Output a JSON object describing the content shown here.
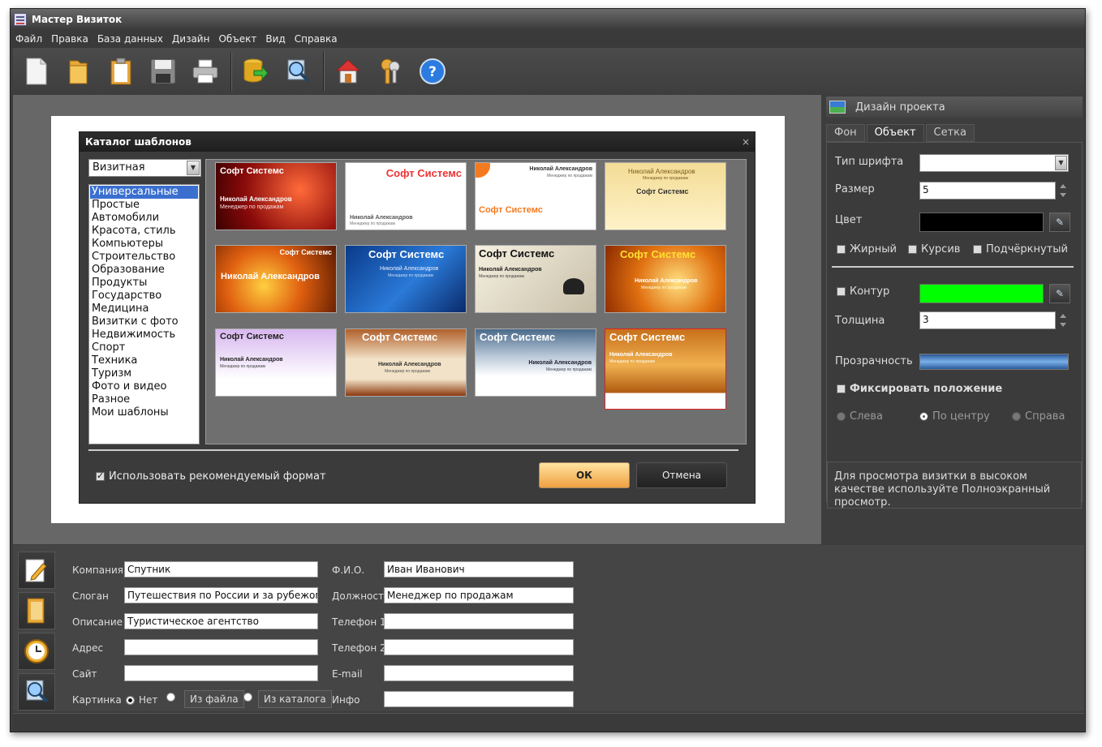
{
  "app": {
    "title": "Мастер Визиток"
  },
  "menu": [
    "Файл",
    "Правка",
    "База данных",
    "Дизайн",
    "Объект",
    "Вид",
    "Справка"
  ],
  "toolbar": {
    "new": "new-file",
    "open": "open-folder",
    "paste": "clipboard",
    "save": "floppy-disk",
    "print": "printer",
    "export": "database-export",
    "search": "magnifier",
    "home": "home",
    "keys": "keys",
    "help": "help"
  },
  "dialog": {
    "title": "Каталог шаблонов",
    "close": "×",
    "type_select": "Визитная",
    "categories": [
      "Универсальные",
      "Простые",
      "Автомобили",
      "Красота, стиль",
      "Компьютеры",
      "Строительство",
      "Образование",
      "Продукты",
      "Государство",
      "Медицина",
      "Визитки с фото",
      "Недвижимость",
      "Спорт",
      "Техника",
      "Туризм",
      "Фото и видео",
      "Разное",
      "Мои шаблоны"
    ],
    "selected_category": "Универсальные",
    "cards": [
      {
        "company": "Софт Системс",
        "name": "Николай Александров",
        "role": "Менеджер по продажам"
      },
      {
        "company": "Софт Системс",
        "name": "Николай Александров",
        "role": "Менеджер по продажам"
      },
      {
        "company": "Софт Системс",
        "name": "Николай Александров",
        "role": "Менеджер по продажам"
      },
      {
        "company": "Софт Системс",
        "name": "Николай Александров",
        "role": "Менеджер по продажам"
      },
      {
        "company": "Софт Системс",
        "name": "Николай Александров",
        "role": ""
      },
      {
        "company": "Софт Системс",
        "name": "Николай Александров",
        "role": "Менеджер по продажам"
      },
      {
        "company": "Софт Системс",
        "name": "Николай Александров",
        "role": "Менеджер по продажам"
      },
      {
        "company": "Софт Системс",
        "name": "Николай Александров",
        "role": "Менеджер по продажам"
      },
      {
        "company": "Софт Системс",
        "name": "Николай Александров",
        "role": "Менеджер по продажам"
      },
      {
        "company": "Софт Системс",
        "name": "Николай Александров",
        "role": "Менеджер по продажам"
      },
      {
        "company": "Софт Системс",
        "name": "Николай Александров",
        "role": "Менеджер по продажам"
      },
      {
        "company": "Софт Системс",
        "name": "Николай Александров",
        "role": "Менеджер по продажам"
      }
    ],
    "use_recommended": "Использовать рекомендуемый формат",
    "ok": "ОК",
    "cancel": "Отмена"
  },
  "right": {
    "header": "Дизайн проекта",
    "tabs": [
      "Фон",
      "Объект",
      "Сетка"
    ],
    "active_tab": "Объект",
    "font_type_label": "Тип шрифта",
    "font_type_value": "",
    "size_label": "Размер",
    "size_value": "5",
    "color_label": "Цвет",
    "color_value": "#000000",
    "bold": "Жирный",
    "italic": "Курсив",
    "underline": "Подчёркнутый",
    "outline_label": "Контур",
    "outline_color": "#00ff00",
    "thickness_label": "Толщина",
    "thickness_value": "3",
    "opacity_label": "Прозрачность",
    "fix_position": "Фиксировать положение",
    "align_left": "Слева",
    "align_center": "По центру",
    "align_right": "Справа",
    "hint": "Для просмотра визитки в высоком качестве используйте Полноэкранный просмотр."
  },
  "form": {
    "company_label": "Компания",
    "company": "Спутник",
    "slogan_label": "Слоган",
    "slogan": "Путешествия по России и за рубежом",
    "desc_label": "Описание",
    "desc": "Туристическое агентство",
    "address_label": "Адрес",
    "address": "",
    "site_label": "Сайт",
    "site": "",
    "picture_label": "Картинка",
    "pic_none": "Нет",
    "pic_file": "Из файла",
    "pic_catalog": "Из каталога",
    "fio_label": "Ф.И.О.",
    "fio": "Иван Иванович",
    "position_label": "Должность",
    "position": "Менеджер по продажам",
    "phone1_label": "Телефон 1",
    "phone1": "",
    "phone2_label": "Телефон 2",
    "phone2": "",
    "email_label": "E-mail",
    "email": "",
    "info_label": "Инфо",
    "info": ""
  }
}
